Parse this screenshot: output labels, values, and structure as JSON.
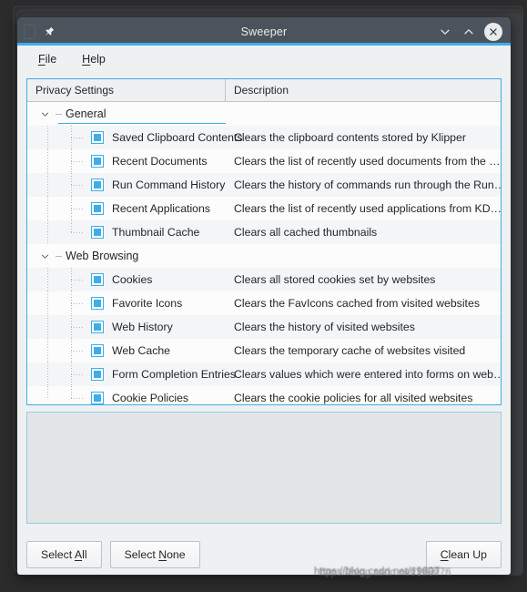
{
  "window": {
    "title": "Sweeper",
    "icons": {
      "app": "app-icon",
      "pin": "pin-icon",
      "minimize": "chevron-down-icon",
      "maximize": "chevron-up-icon",
      "close": "close-icon"
    }
  },
  "menubar": {
    "items": [
      {
        "label": "File",
        "accel": "F",
        "rest": "ile"
      },
      {
        "label": "Help",
        "accel": "H",
        "rest": "elp"
      }
    ]
  },
  "tree": {
    "columns": [
      {
        "label": "Privacy Settings"
      },
      {
        "label": "Description"
      }
    ],
    "groups": [
      {
        "label": "General",
        "expanded": true,
        "current": true,
        "items": [
          {
            "label": "Saved Clipboard Contents",
            "description": "Clears the clipboard contents stored by Klipper",
            "checked": true
          },
          {
            "label": "Recent Documents",
            "description": "Clears the list of recently used documents from the …",
            "checked": true
          },
          {
            "label": "Run Command History",
            "description": "Clears the history of commands run through the Run…",
            "checked": true
          },
          {
            "label": "Recent Applications",
            "description": "Clears the list of recently used applications from KD…",
            "checked": true
          },
          {
            "label": "Thumbnail Cache",
            "description": "Clears all cached thumbnails",
            "checked": true
          }
        ]
      },
      {
        "label": "Web Browsing",
        "expanded": true,
        "current": false,
        "items": [
          {
            "label": "Cookies",
            "description": "Clears all stored cookies set by websites",
            "checked": true
          },
          {
            "label": "Favorite Icons",
            "description": "Clears the FavIcons cached from visited websites",
            "checked": true
          },
          {
            "label": "Web History",
            "description": "Clears the history of visited websites",
            "checked": true
          },
          {
            "label": "Web Cache",
            "description": "Clears the temporary cache of websites visited",
            "checked": true
          },
          {
            "label": "Form Completion Entries",
            "description": "Clears values which were entered into forms on web…",
            "checked": true
          },
          {
            "label": "Cookie Policies",
            "description": "Clears the cookie policies for all visited websites",
            "checked": true
          }
        ]
      }
    ]
  },
  "logpanel": {
    "text": ""
  },
  "buttons": {
    "select_all": {
      "pre": "Select ",
      "accel": "A",
      "post": "ll"
    },
    "select_none": {
      "pre": "Select ",
      "accel": "N",
      "post": "one"
    },
    "clean_up": {
      "pre": "",
      "accel": "C",
      "post": "lean Up"
    }
  },
  "watermark": {
    "line1": "https://blog.csdn.net/19807",
    "line2": "https://blog.csdn.net/198076"
  },
  "colors": {
    "accent": "#3daee9",
    "titlebar": "#4b545c",
    "window_bg": "#eff0f1",
    "desktop_bg": "#2b2b2b",
    "text": "#232629"
  }
}
